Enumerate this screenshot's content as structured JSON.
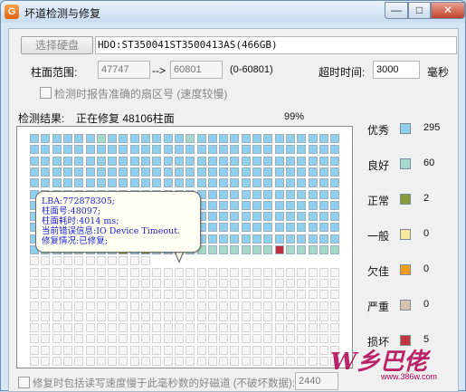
{
  "window": {
    "title": "坏道检测与修复",
    "app_icon": "G",
    "min": "—",
    "max": "□",
    "close": "✕"
  },
  "disk": {
    "select_label": "选择硬盘",
    "value": "HDO:ST350041ST3500413AS(466GB)"
  },
  "range": {
    "label": "柱面范围:",
    "from": "47747",
    "arrow": "-->",
    "to": "60801",
    "hint": "(0-60801)"
  },
  "timeout": {
    "label": "超时时间:",
    "value": "3000",
    "unit": "毫秒"
  },
  "report_option": {
    "label": "检测时报告准确的扇区号 (速度较慢)",
    "checked": false
  },
  "result": {
    "label": "检测结果:",
    "status": "正在修复 48106柱面",
    "percent": "99%"
  },
  "tooltip": {
    "lines": [
      "LBA:772878305;",
      "柱面号:48097;",
      "柱面耗时:4014 ms;",
      "当前错误信息:IO Device Timeout.",
      "修复情况:已修复;"
    ]
  },
  "legend": [
    {
      "name": "优秀",
      "count": "295",
      "color": "#8fd0ef"
    },
    {
      "name": "良好",
      "count": "60",
      "color": "#a7d9c8"
    },
    {
      "name": "正常",
      "count": "2",
      "color": "#8a9a3a"
    },
    {
      "name": "一般",
      "count": "0",
      "color": "#f5e99a"
    },
    {
      "name": "欠佳",
      "count": "0",
      "color": "#f29a1a"
    },
    {
      "name": "严重",
      "count": "0",
      "color": "#d8c4ad"
    },
    {
      "name": "损坏",
      "count": "5",
      "color": "#c2303e"
    }
  ],
  "bottom": {
    "label": "修复时包括读写速度慢于此毫秒数的好磁道 (不破坏数据):",
    "value": "2440"
  },
  "watermark": {
    "text": "W乡巴佬",
    "url": "www.386w.com"
  }
}
